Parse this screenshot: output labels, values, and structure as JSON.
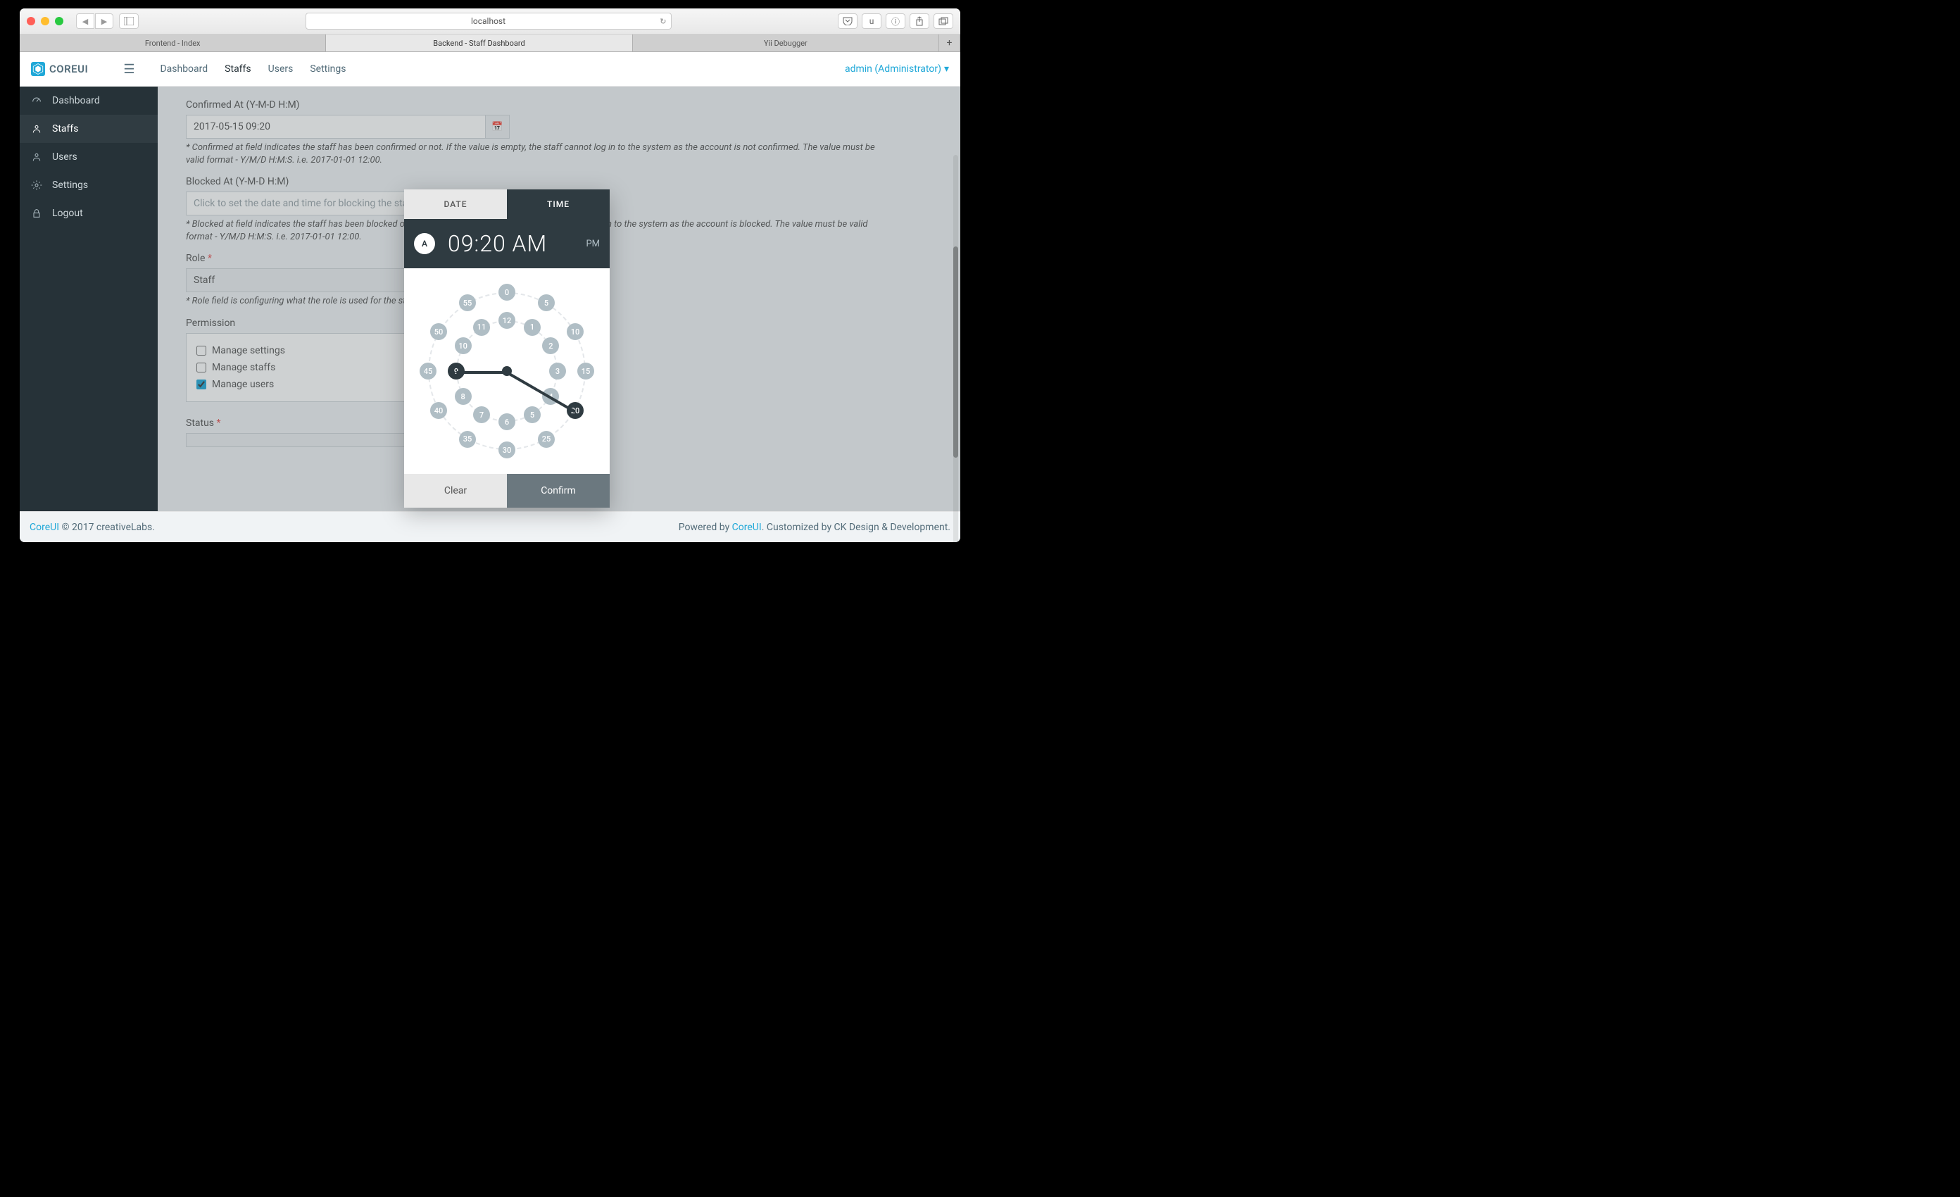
{
  "browser": {
    "url": "localhost",
    "tabs": [
      "Frontend - Index",
      "Backend - Staff Dashboard",
      "Yii Debugger"
    ],
    "active_tab": 1,
    "toolbar_icons": [
      "pocket",
      "u",
      "info",
      "share",
      "tabs"
    ]
  },
  "header": {
    "brand": "COREUI",
    "nav": [
      {
        "label": "Dashboard"
      },
      {
        "label": "Staffs",
        "active": true
      },
      {
        "label": "Users"
      },
      {
        "label": "Settings"
      }
    ],
    "user": "admin (Administrator)"
  },
  "sidebar": [
    {
      "icon": "speed",
      "label": "Dashboard"
    },
    {
      "icon": "person",
      "label": "Staffs",
      "active": true
    },
    {
      "icon": "person",
      "label": "Users"
    },
    {
      "icon": "gear",
      "label": "Settings"
    },
    {
      "icon": "lock",
      "label": "Logout"
    }
  ],
  "form": {
    "confirmed_label": "Confirmed At (Y-M-D H:M)",
    "confirmed_value": "2017-05-15 09:20",
    "confirmed_hint": "* Confirmed at field indicates the staff has been confirmed or not. If the value is empty, the staff cannot log in to the system as the account is not confirmed. The value must be valid format - Y/M/D H:M:S. i.e. 2017-01-01 12:00.",
    "blocked_label": "Blocked At (Y-M-D H:M)",
    "blocked_placeholder": "Click to set the date and time for blocking the staff.",
    "blocked_hint": "* Blocked at field indicates the staff has been blocked or not. If the value is not empty, the staff cannot log in to the system as the account is blocked. The value must be valid format - Y/M/D H:M:S. i.e. 2017-01-01 12:00.",
    "role_label": "Role",
    "role_value": "Staff",
    "role_hint": "* Role field is configuring what the role is used for the staff.",
    "permission_label": "Permission",
    "permissions": [
      {
        "label": "Manage settings",
        "checked": false
      },
      {
        "label": "Manage staffs",
        "checked": false
      },
      {
        "label": "Manage users",
        "checked": true
      }
    ],
    "status_label": "Status"
  },
  "picker": {
    "tabs": {
      "date": "DATE",
      "time": "TIME"
    },
    "ampill": "A",
    "time": "09:20 AM",
    "pm": "PM",
    "inner_hours": [
      "12",
      "1",
      "2",
      "3",
      "4",
      "5",
      "6",
      "7",
      "8",
      "9",
      "10",
      "11"
    ],
    "outer_mins": [
      "0",
      "5",
      "10",
      "15",
      "20",
      "25",
      "30",
      "35",
      "40",
      "45",
      "50",
      "55"
    ],
    "selected_hour": "9",
    "selected_min": "20",
    "clear": "Clear",
    "confirm": "Confirm"
  },
  "footer": {
    "brand": "CoreUI",
    "left": " © 2017 creativeLabs.",
    "right_pre": "Powered by ",
    "right_link": "CoreUI",
    "right_post": ". Customized by CK Design & Development."
  }
}
